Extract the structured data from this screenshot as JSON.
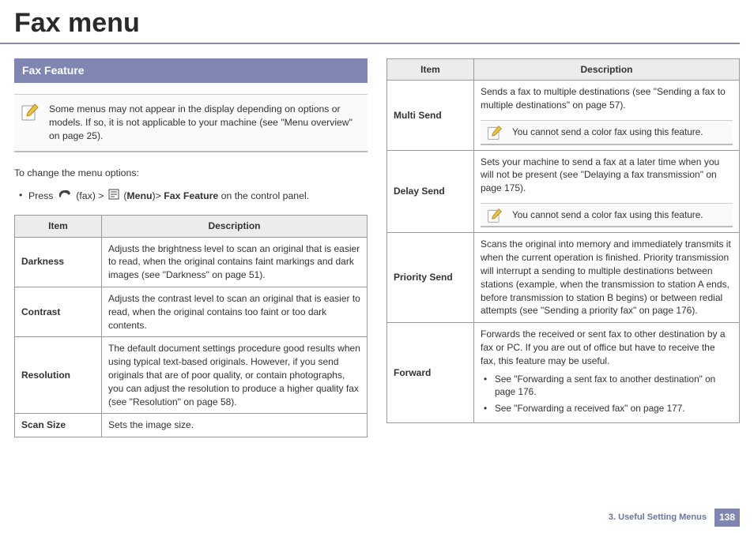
{
  "title": "Fax menu",
  "section_heading": "Fax Feature",
  "top_note": "Some menus may not appear in the display depending on options or models. If so, it is not applicable to your machine (see \"Menu overview\" on page 25).",
  "instruction_intro": "To change the menu options:",
  "press_line": {
    "prefix": "Press ",
    "fax_label": " (fax) > ",
    "menu_label_open": " (",
    "menu_bold": "Menu",
    "menu_label_close": ")> ",
    "feature_bold": "Fax Feature",
    "suffix": " on the control panel."
  },
  "table_left": {
    "headers": {
      "item": "Item",
      "desc": "Description"
    },
    "rows": [
      {
        "item": "Darkness",
        "desc": "Adjusts the brightness level to scan an original that is easier to read, when the original contains faint markings and dark images (see \"Darkness\" on page 51)."
      },
      {
        "item": "Contrast",
        "desc": "Adjusts the contrast level to scan an original that is easier to read, when the original contains too faint or too dark contents."
      },
      {
        "item": "Resolution",
        "desc": "The default document settings procedure good results when using typical text-based originals. However, if you send originals that are of poor quality, or contain photographs, you can adjust the resolution to produce a higher quality fax (see \"Resolution\" on page 58)."
      },
      {
        "item": "Scan Size",
        "desc": "Sets the image size."
      }
    ]
  },
  "table_right": {
    "headers": {
      "item": "Item",
      "desc": "Description"
    },
    "rows": [
      {
        "item": "Multi Send",
        "desc": "Sends a fax to multiple destinations (see \"Sending a fax to multiple destinations\" on page 57).",
        "note": "You cannot send a color fax using this feature."
      },
      {
        "item": "Delay Send",
        "desc": "Sets your machine to send a fax at a later time when you will not be present (see \"Delaying a fax transmission\" on page 175).",
        "note": "You cannot send a color fax using this feature."
      },
      {
        "item": "Priority Send",
        "desc": "Scans the original into memory and immediately transmits it when the current operation is finished. Priority transmission will interrupt a sending to multiple destinations between stations (example, when the transmission to station A ends, before transmission to station B begins) or between redial attempts (see \"Sending a priority fax\" on page 176)."
      },
      {
        "item": "Forward",
        "desc": "Forwards the received or sent fax to other destination by a fax or PC. If you are out of office but have to receive the fax, this feature may be useful.",
        "see": [
          "See \"Forwarding a sent fax to another destination\" on page 176.",
          "See \"Forwarding a received fax\" on page 177."
        ]
      }
    ]
  },
  "footer": {
    "chapter": "3.  Useful Setting Menus",
    "page": "138"
  }
}
